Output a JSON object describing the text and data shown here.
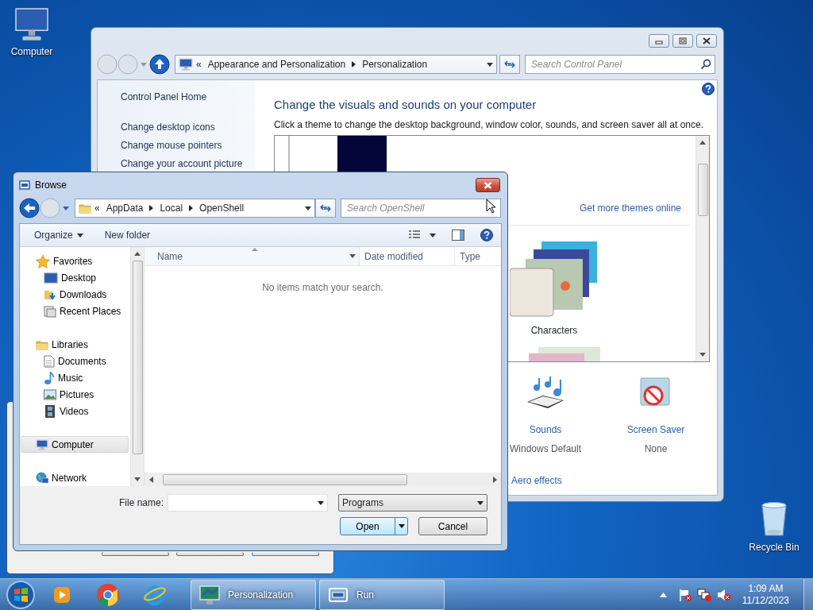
{
  "desktop": {
    "icons": [
      {
        "label": "Computer"
      },
      {
        "label": "Recycle Bin"
      }
    ]
  },
  "control_panel": {
    "address": {
      "chevron": "«",
      "crumbs": [
        "Appearance and Personalization",
        "Personalization"
      ]
    },
    "search": {
      "placeholder": "Search Control Panel"
    },
    "sidebar": [
      "Control Panel Home",
      "Change desktop icons",
      "Change mouse pointers",
      "Change your account picture"
    ],
    "heading": "Change the visuals and sounds on your computer",
    "description": "Click a theme to change the desktop background, window color, sounds, and screen saver all at once.",
    "themes_link": "Get more themes online",
    "themes": [
      {
        "name": "Characters"
      }
    ],
    "settings": [
      {
        "label": "Sounds",
        "value": "Windows Default"
      },
      {
        "label": "Screen Saver",
        "value": "None"
      }
    ],
    "aero_link": "Aero effects"
  },
  "browse_dialog": {
    "title": "Browse",
    "address": {
      "chevron": "«",
      "crumbs": [
        "AppData",
        "Local",
        "OpenShell"
      ]
    },
    "search": {
      "placeholder": "Search OpenShell"
    },
    "toolbar": [
      {
        "label": "Organize",
        "dropdown": true
      },
      {
        "label": "New folder",
        "dropdown": false
      }
    ],
    "nav_pane": [
      {
        "label": "Favorites",
        "selected": false,
        "children": [
          {
            "label": "Desktop",
            "selected": false
          },
          {
            "label": "Downloads",
            "selected": false
          },
          {
            "label": "Recent Places",
            "selected": false
          }
        ]
      },
      {
        "label": "Libraries",
        "selected": false,
        "children": [
          {
            "label": "Documents",
            "selected": false
          },
          {
            "label": "Music",
            "selected": false
          },
          {
            "label": "Pictures",
            "selected": false
          },
          {
            "label": "Videos",
            "selected": false
          }
        ]
      },
      {
        "label": "Computer",
        "selected": true
      },
      {
        "label": "Network",
        "selected": false
      }
    ],
    "columns": [
      "Name",
      "Date modified",
      "Type"
    ],
    "empty_message": "No items match your search.",
    "file_name_label": "File name:",
    "file_type": "Programs",
    "buttons": [
      "Open",
      "Cancel"
    ]
  },
  "taskbar": {
    "tasks": [
      {
        "label": "Personalization"
      },
      {
        "label": "Run"
      }
    ],
    "clock": {
      "time": "1:09 AM",
      "date": "11/12/2023"
    }
  }
}
